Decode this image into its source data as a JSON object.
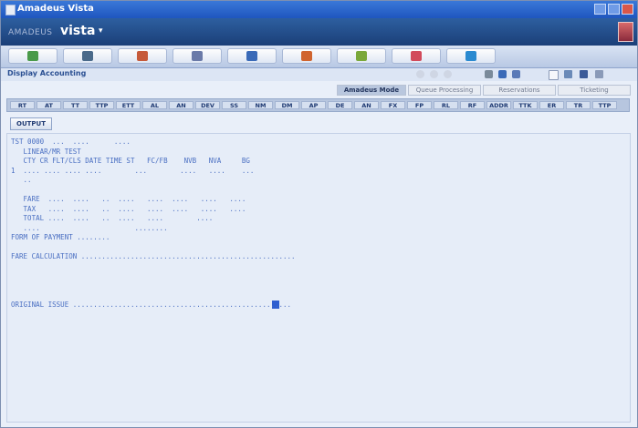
{
  "window": {
    "title": "Amadeus Vista",
    "brand_small": "AMADEUS",
    "brand_big": "vista"
  },
  "toolbar": {
    "icons": [
      "globe-icon",
      "book-icon",
      "currency-icon",
      "plane-icon",
      "car-icon",
      "hotel-icon",
      "shield-icon",
      "document-icon",
      "world-icon"
    ]
  },
  "section": {
    "label": "Display Accounting"
  },
  "tabs": [
    {
      "label": "Amadeus Mode",
      "active": true
    },
    {
      "label": "Queue Processing",
      "active": false
    },
    {
      "label": "Reservations",
      "active": false
    },
    {
      "label": "Ticketing",
      "active": false
    }
  ],
  "keys": [
    "RT",
    "AT",
    "TT",
    "TTP",
    "ETT",
    "AL",
    "AN",
    "DEV",
    "SS",
    "NM",
    "DM",
    "AP",
    "DE",
    "AN",
    "FX",
    "FP",
    "RL",
    "RF",
    "ADDR",
    "TTK",
    "ER",
    "TR",
    "TTP"
  ],
  "output_button": "OUTPUT",
  "terminal": {
    "lines": [
      "TST 0000  ...  ....      ....",
      "   LINEAR/MR TEST",
      "   CTY CR FLT/CLS DATE TIME ST   FC/FB    NVB   NVA     BG",
      "1  .... .... .... ....        ...        ....   ....    ...",
      "   ..",
      "",
      "   FARE  ....  ....   ..  ....   ....  ....   ....   ....",
      "   TAX   ....  ....   ..  ....   ....  ....   ....   ....",
      "   TOTAL ....  ....   ..  ....   ....        ....",
      "   ....                       ........",
      "FORM OF PAYMENT ........",
      "",
      "FARE CALCULATION ....................................................",
      "",
      "",
      "",
      "",
      "ORIGINAL ISSUE .....................................................",
      ""
    ]
  },
  "colors": {
    "titlebar": "#1f56bf",
    "brandbar": "#1b3f78",
    "terminal_text": "#4a6fc2",
    "terminal_bg": "#e6edf8"
  }
}
